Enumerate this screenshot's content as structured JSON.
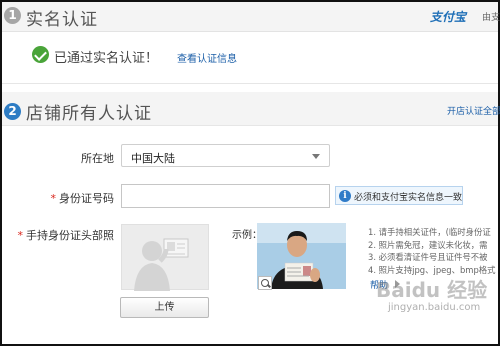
{
  "section1": {
    "number": "1",
    "title": "实名认证",
    "brand_logo": "支付宝",
    "brand_suffix": "由支",
    "status_icon": "check-circle-icon",
    "status_text": "已通过实名认证！",
    "view_link": "查看认证信息"
  },
  "section2": {
    "number": "2",
    "title": "店铺所有人认证",
    "open_link": "开店认证全部",
    "location_label": "所在地",
    "location_value": "中国大陆",
    "id_label": "身份证号码",
    "id_value": "",
    "id_tip": "必须和支付宝实名信息一致",
    "photo_label": "手持身份证头部照",
    "upload_label": "上传",
    "example_label": "示例：",
    "notes": [
      "1. 请手持相关证件，(临时身份证",
      "2. 照片需免冠，建议未化妆，需",
      "3. 必须看清证件号且证件号不被",
      "4. 照片支持jpg、jpeg、bmp格式"
    ],
    "help_label": "帮助"
  },
  "watermark": {
    "brand": "Baidu 经验",
    "url": "jingyan.baidu.com"
  },
  "colors": {
    "link_blue": "#1c5fa8",
    "badge_blue": "#2d7cc4",
    "check_green": "#4aa43a",
    "required_red": "#d9261c"
  }
}
